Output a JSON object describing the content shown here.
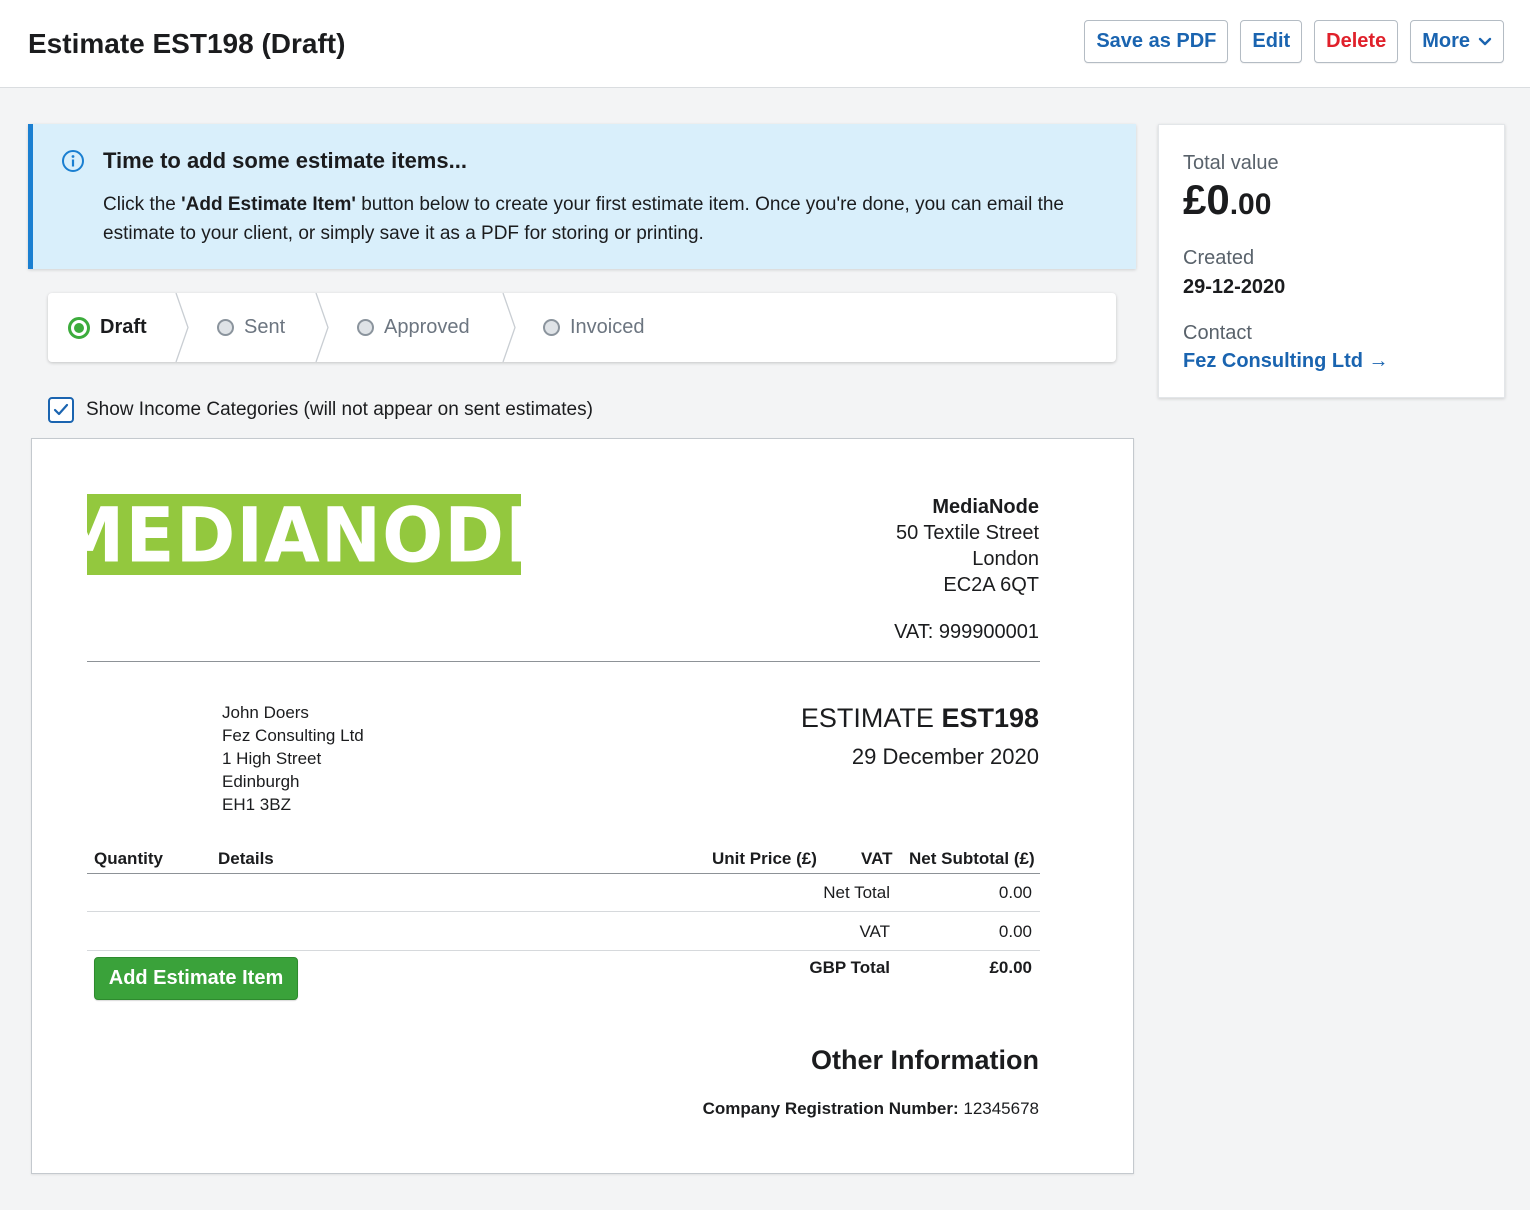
{
  "header": {
    "title": "Estimate EST198 (Draft)",
    "save_pdf_label": "Save as PDF",
    "edit_label": "Edit",
    "delete_label": "Delete",
    "more_label": "More",
    "delete_color": "#e0212b",
    "link_color": "#1a64b0"
  },
  "banner": {
    "title": "Time to add some estimate items...",
    "text_before": "Click the ",
    "text_bold": "'Add Estimate Item'",
    "text_after": " button below to create your first estimate item. Once you're done, you can email the estimate to your client, or simply save it as a PDF for storing or printing.",
    "icon": "info-icon",
    "accent_color": "#1a7fd1"
  },
  "steps": [
    {
      "label": "Draft",
      "active": true
    },
    {
      "label": "Sent",
      "active": false
    },
    {
      "label": "Approved",
      "active": false
    },
    {
      "label": "Invoiced",
      "active": false
    }
  ],
  "income_categories": {
    "checked": true,
    "label": "Show Income Categories (will not appear on sent estimates)"
  },
  "document": {
    "logo_text": "MEDIANODE",
    "logo_color": "#93c83e",
    "company": {
      "name": "MediaNode",
      "address_1": "50 Textile Street",
      "city": "London",
      "postcode": "EC2A 6QT",
      "vat": "VAT: 999900001"
    },
    "client": {
      "person": "John Doers",
      "company": "Fez Consulting Ltd",
      "address_1": "1 High Street",
      "city": "Edinburgh",
      "postcode": "EH1 3BZ"
    },
    "estimate_label": "ESTIMATE",
    "estimate_number": "EST198",
    "estimate_date": "29 December 2020",
    "table": {
      "headers": {
        "quantity": "Quantity",
        "details": "Details",
        "unit_price": "Unit Price (£)",
        "vat": "VAT",
        "net_subtotal": "Net Subtotal (£)"
      },
      "net_total_label": "Net Total",
      "net_total_value": "0.00",
      "vat_label": "VAT",
      "vat_value": "0.00",
      "gbp_total_label": "GBP Total",
      "gbp_total_value": "£0.00"
    },
    "add_item_label": "Add Estimate Item",
    "add_item_color": "#3aa23a",
    "other_info_title": "Other Information",
    "reg_label": "Company Registration Number:",
    "reg_value": "12345678"
  },
  "sidebar": {
    "total_value_label": "Total value",
    "total_value_main": "£0",
    "total_value_decimals": ".00",
    "created_label": "Created",
    "created_value": "29-12-2020",
    "contact_label": "Contact",
    "contact_value": "Fez Consulting Ltd →"
  }
}
